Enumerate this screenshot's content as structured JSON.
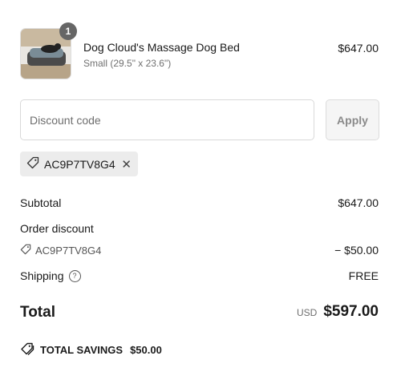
{
  "product": {
    "quantity": "1",
    "title": "Dog Cloud's Massage Dog Bed",
    "variant": "Small (29.5\" x 23.6\")",
    "price": "$647.00"
  },
  "discount": {
    "placeholder": "Discount code",
    "apply_label": "Apply",
    "applied_code": "AC9P7TV8G4"
  },
  "summary": {
    "subtotal_label": "Subtotal",
    "subtotal_value": "$647.00",
    "order_discount_label": "Order discount",
    "discount_code": "AC9P7TV8G4",
    "discount_value": "− $50.00",
    "shipping_label": "Shipping",
    "shipping_value": "FREE",
    "total_label": "Total",
    "currency": "USD",
    "total_value": "$597.00",
    "savings_label": "TOTAL SAVINGS",
    "savings_value": "$50.00"
  }
}
